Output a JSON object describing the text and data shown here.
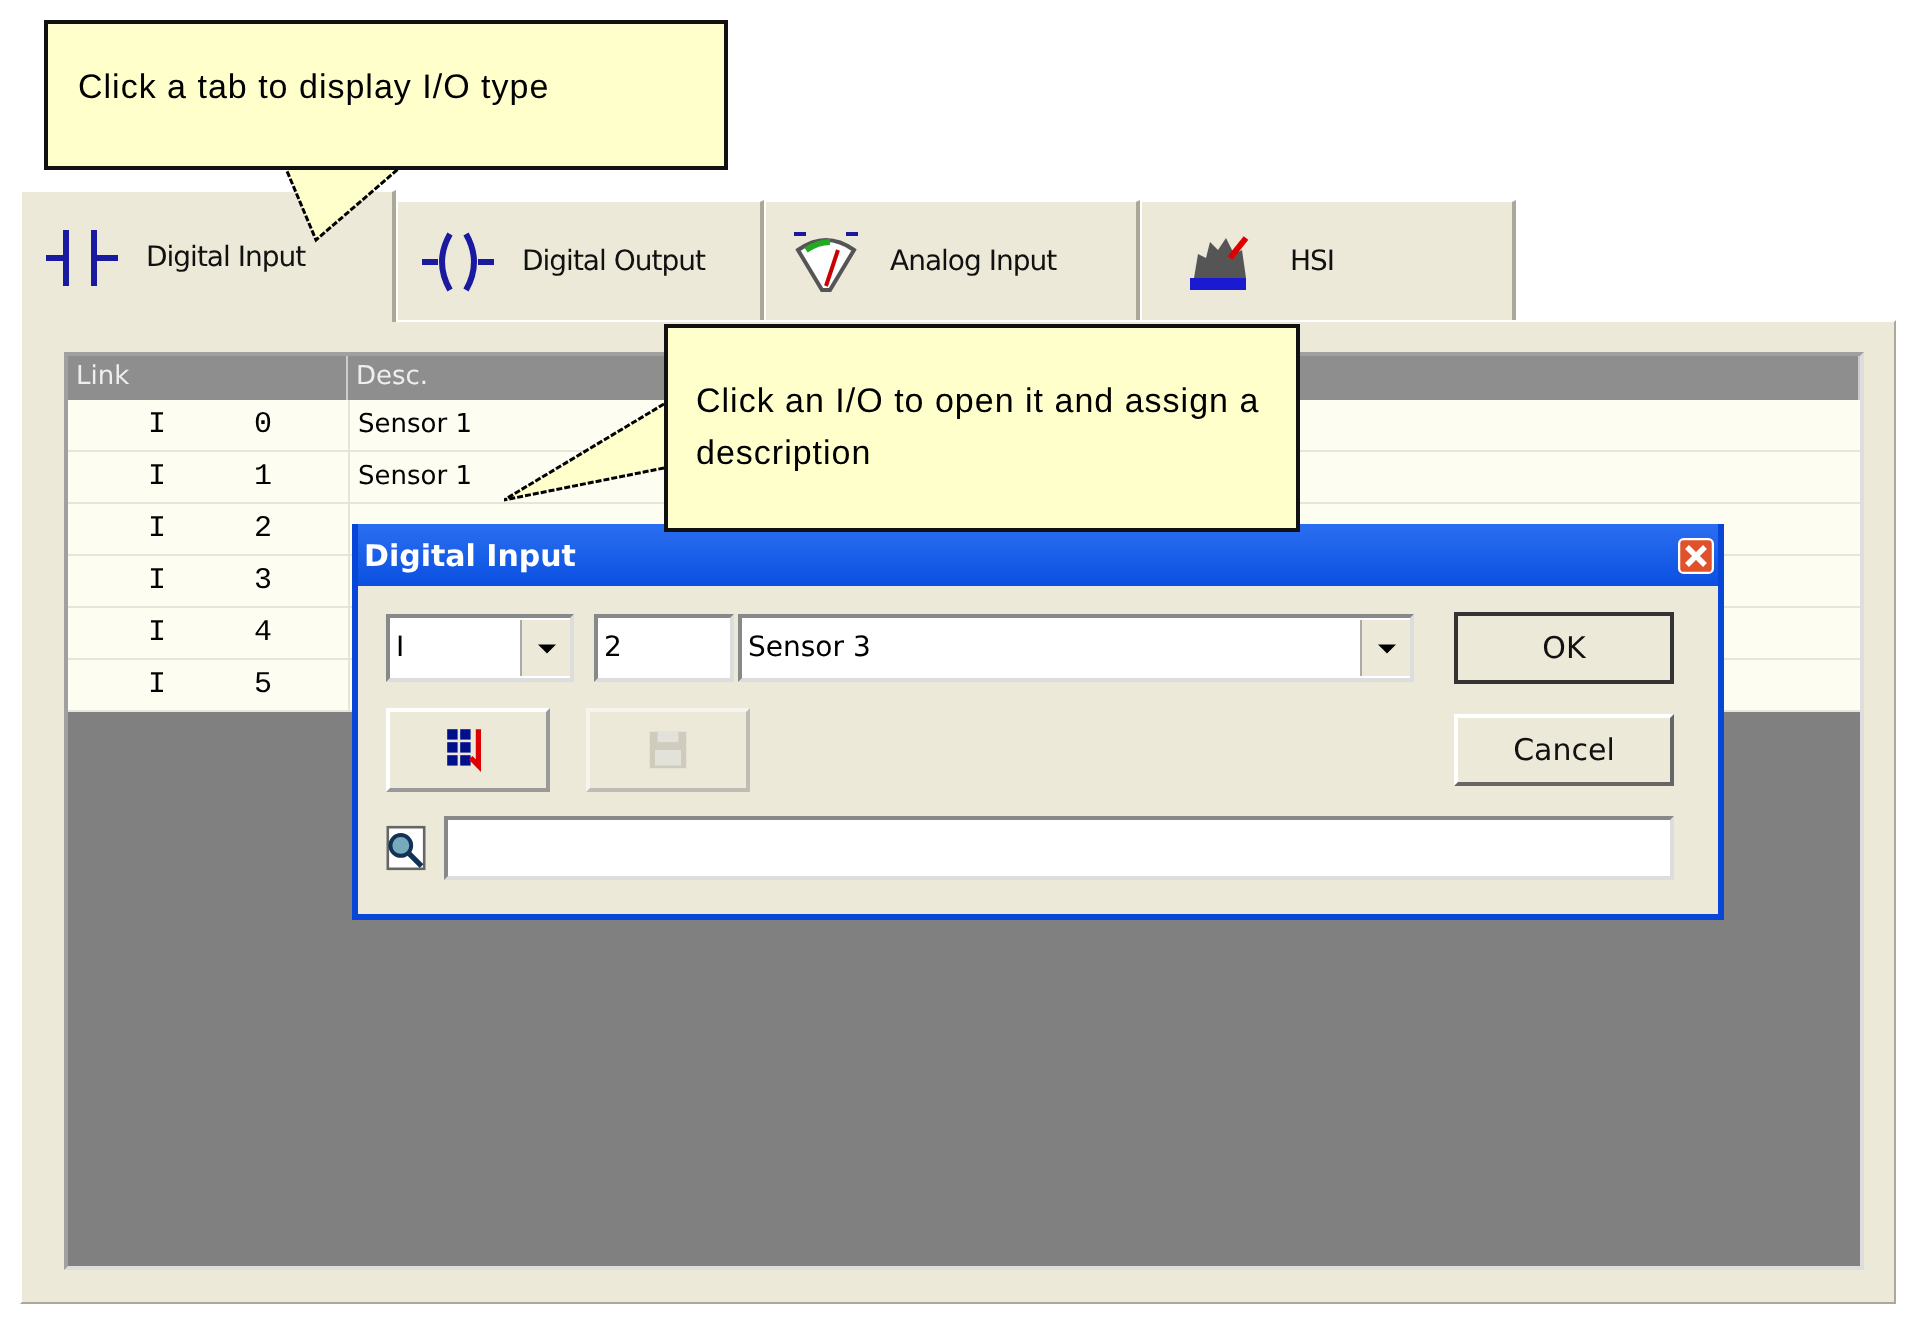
{
  "callouts": [
    {
      "text": "Click a tab to display I/O type"
    },
    {
      "text": "Click an I/O to open it and assign a description"
    }
  ],
  "tabs": [
    {
      "label": "Digital Input",
      "kind": "contact",
      "selected": true
    },
    {
      "label": "Digital Output",
      "kind": "coil",
      "selected": false
    },
    {
      "label": "Analog Input",
      "kind": "gauge",
      "selected": false
    },
    {
      "label": "HSI",
      "kind": "hsi",
      "selected": false
    }
  ],
  "table": {
    "columns": [
      "Link",
      "Desc."
    ],
    "rows": [
      {
        "type": "I",
        "number": "0",
        "desc": "Sensor 1"
      },
      {
        "type": "I",
        "number": "1",
        "desc": "Sensor 1"
      },
      {
        "type": "I",
        "number": "2"
      },
      {
        "type": "I",
        "number": "3"
      },
      {
        "type": "I",
        "number": "4"
      },
      {
        "type": "I",
        "number": "5"
      }
    ]
  },
  "dialog": {
    "title": "Digital Input",
    "type_value": "I",
    "number": "2",
    "description": "Sensor 3",
    "tool_buttons": [
      {
        "kind": "grid",
        "disabled": false
      },
      {
        "kind": "save",
        "disabled": true
      }
    ],
    "ok": "OK",
    "cancel": "Cancel"
  }
}
